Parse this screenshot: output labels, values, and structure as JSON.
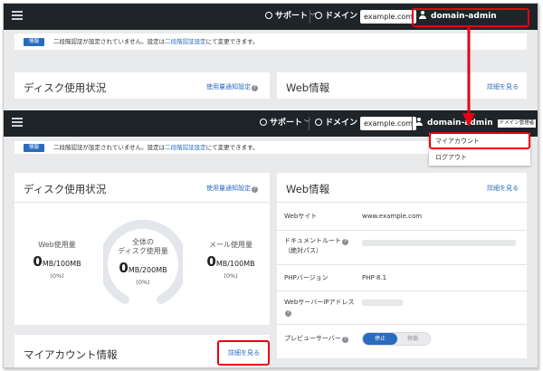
{
  "nav": {
    "support_label": "サポート",
    "domain_label": "ドメイン",
    "domain_value": "example.com",
    "username": "domain-admin",
    "role_badge": "ドメイン管理者"
  },
  "notice": {
    "badge": "情報",
    "text_before": "二段階認証が設定されていません。設定は",
    "link": "二段階認証設定",
    "text_after": "にて変更できます。"
  },
  "disk": {
    "title": "ディスク使用状況",
    "link": "使用量通知設定",
    "web": {
      "label": "Web使用量",
      "value": "0",
      "unit": "MB/100MB",
      "pct": "(0%)"
    },
    "total": {
      "label_line1": "全体の",
      "label_line2": "ディスク使用量",
      "value": "0",
      "unit": "MB/200MB",
      "pct": "(0%)"
    },
    "mail": {
      "label": "メール使用量",
      "value": "0",
      "unit": "MB/100MB",
      "pct": "(0%)"
    },
    "usage_fraction": 0
  },
  "web_info": {
    "title": "Web情報",
    "link": "詳細を見る",
    "rows": [
      {
        "key": "Webサイト",
        "value": "www.example.com"
      },
      {
        "key_line1": "ドキュメントルート",
        "key_line2": "（絶対パス）"
      },
      {
        "key": "PHPバージョン",
        "value": "PHP 8.1"
      },
      {
        "key": "WebサーバーIPアドレス"
      },
      {
        "key": "プレビューサーバー",
        "toggle_on": "停止",
        "toggle_off": "稼働"
      }
    ]
  },
  "account": {
    "title": "マイアカウント情報",
    "link": "詳細を見る"
  },
  "dropdown": {
    "items": [
      "マイアカウント",
      "ログアウト"
    ]
  },
  "colors": {
    "accent": "#2a6bbf",
    "highlight": "#e60012",
    "topbar": "#1f2429"
  }
}
